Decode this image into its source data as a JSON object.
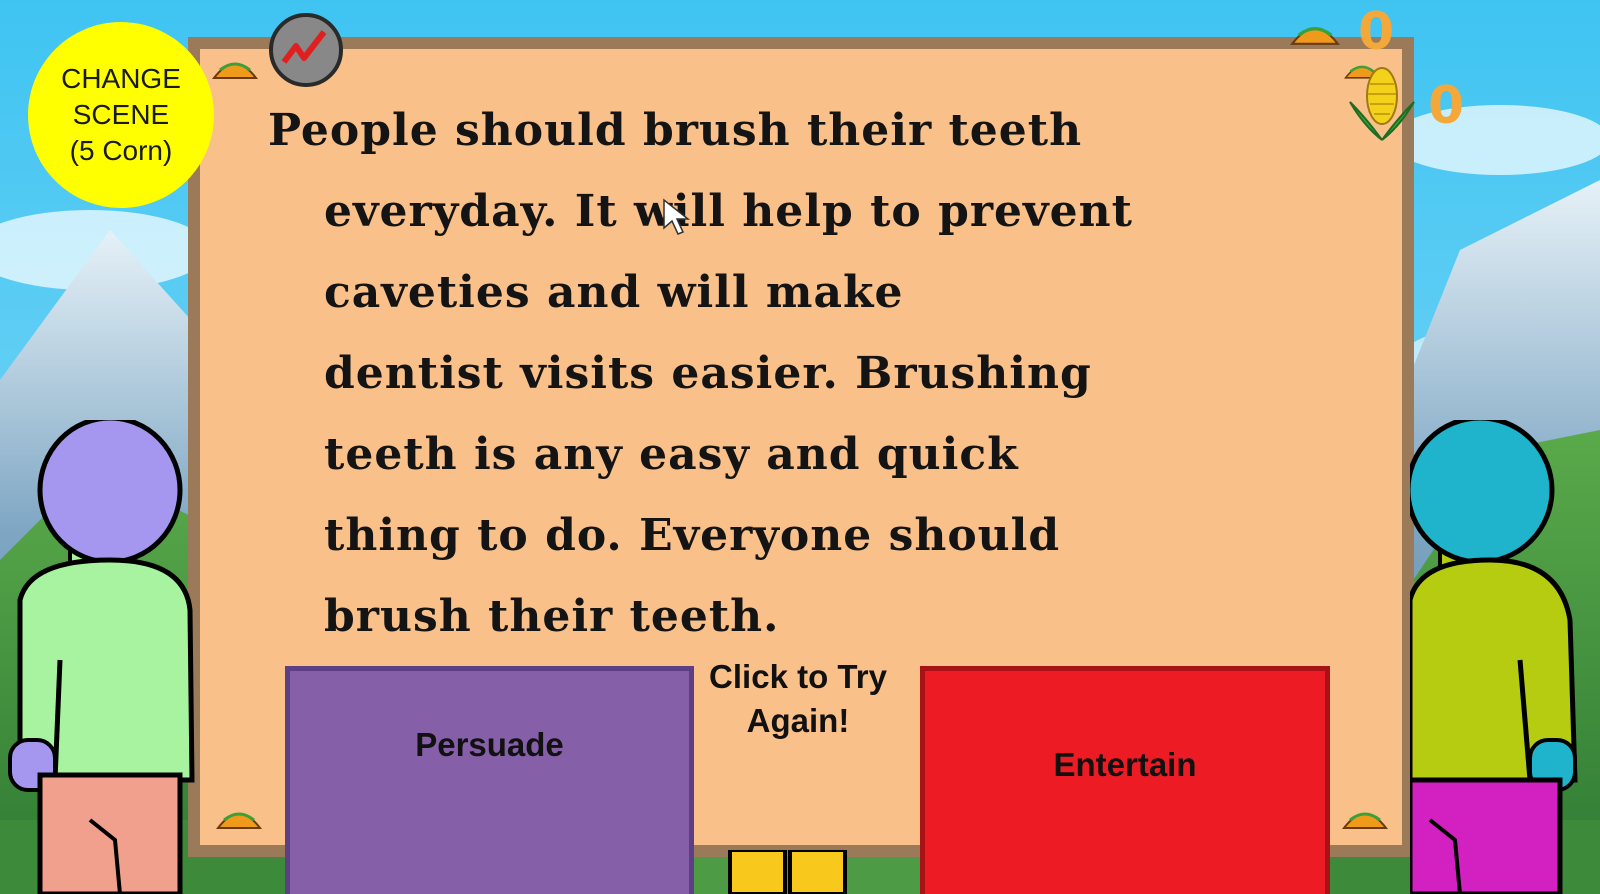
{
  "game": {
    "passage_lines": [
      "People should brush their teeth",
      "everyday. It will help to prevent",
      "caveties and will make",
      "dentist visits easier. Brushing",
      "teeth is any easy and quick",
      "thing to do. Everyone should",
      "brush their teeth."
    ],
    "change_scene_label": "CHANGE\nSCENE\n(5 Corn)",
    "try_again_label": "Click to Try Again!",
    "persuade_label": "Persuade",
    "entertain_label": "Entertain",
    "taco_count": "0",
    "corn_count": "0"
  },
  "colors": {
    "board": "#f9c08a",
    "board_frame": "#9a7a58",
    "persuade": "#8560a8",
    "entertain": "#ed1c24",
    "change_scene": "#ffff00",
    "counter": "#f4a83a"
  },
  "icons": [
    "graph-icon",
    "taco-icon",
    "corn-icon",
    "mouse-cursor-icon"
  ]
}
